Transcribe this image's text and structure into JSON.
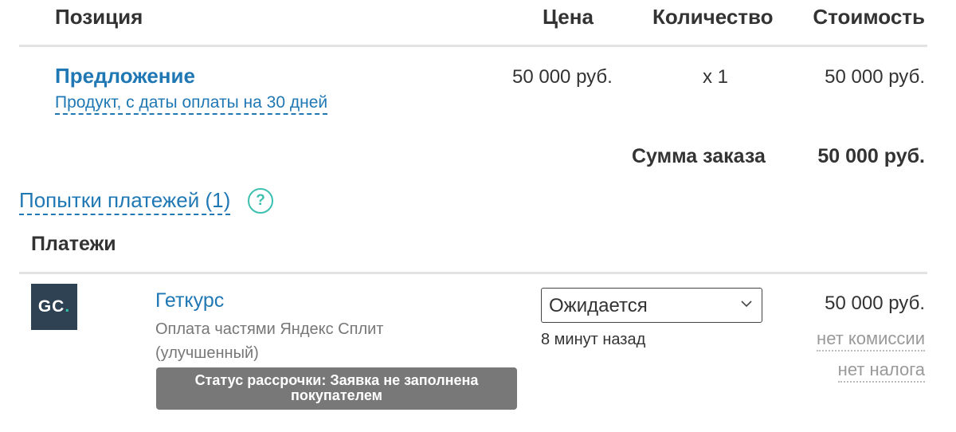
{
  "table": {
    "headers": {
      "position": "Позиция",
      "price": "Цена",
      "quantity": "Количество",
      "cost": "Стоимость"
    },
    "rows": [
      {
        "title": "Предложение",
        "subtitle": "Продукт, с даты оплаты на 30 дней",
        "price": "50 000 руб.",
        "quantity": "x 1",
        "cost": "50 000 руб."
      }
    ]
  },
  "order_total": {
    "label": "Сумма заказа",
    "value": "50 000 руб."
  },
  "payment_attempts": {
    "label": "Попытки платежей (1)",
    "help_glyph": "?",
    "help_icon": "question-circle-icon",
    "accent_color": "#3cc0b0"
  },
  "payments": {
    "heading": "Платежи",
    "items": [
      {
        "logo_text": "GC",
        "logo_dot": ".",
        "logo_icon": "getcourse-logo-icon",
        "provider": "Геткурс",
        "description": "Оплата частями Яндекс Сплит (улучшенный)",
        "badge": "Статус рассрочки: Заявка не заполнена покупателем",
        "status": "Ожидается",
        "time": "8 минут назад",
        "amount": "50 000 руб.",
        "commission": "нет комиссии",
        "tax": "нет налога"
      }
    ]
  },
  "colors": {
    "link": "#1f78b4",
    "text": "#333333",
    "muted": "#999999",
    "badge_bg": "#787878",
    "divider": "#e3e3e3"
  }
}
